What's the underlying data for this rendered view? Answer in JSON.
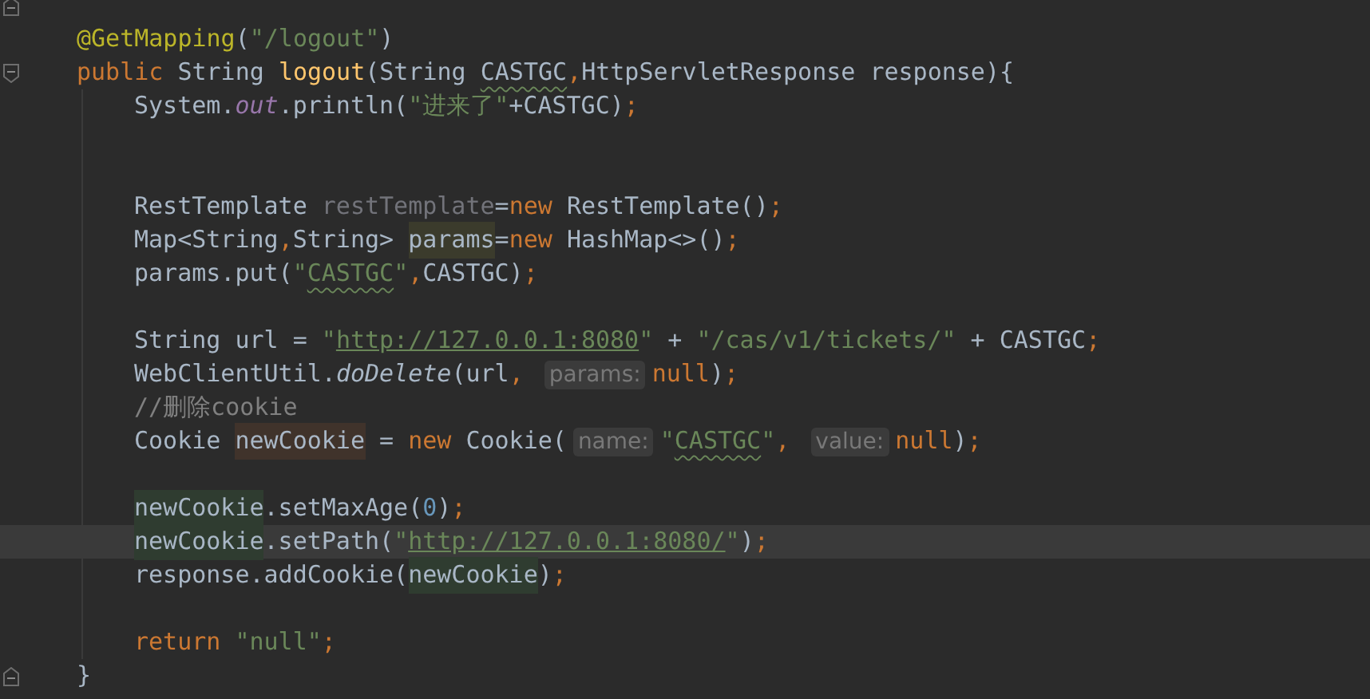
{
  "editor": {
    "lines": [
      {
        "kind": "blank",
        "gutter_marker": {
          "kind": "fold_end"
        }
      },
      {
        "kind": "code",
        "tokens": [
          {
            "kind": "annotation",
            "text": "@GetMapping"
          },
          {
            "kind": "plain",
            "text": "("
          },
          {
            "kind": "string",
            "text": "\"/logout\""
          },
          {
            "kind": "plain",
            "text": ")"
          }
        ]
      },
      {
        "kind": "code",
        "gutter_marker": {
          "kind": "fold_start"
        },
        "tokens": [
          {
            "kind": "keyword",
            "text": "public "
          },
          {
            "kind": "plain",
            "text": "String "
          },
          {
            "kind": "method",
            "text": "logout"
          },
          {
            "kind": "plain",
            "text": "(String "
          },
          {
            "kind": "plain",
            "text": "CASTGC",
            "squiggle": true
          },
          {
            "kind": "punct",
            "text": ","
          },
          {
            "kind": "plain",
            "text": "HttpServletResponse response){"
          }
        ],
        "children": [
          {
            "kind": "code",
            "tokens": [
              {
                "kind": "plain",
                "text": "System."
              },
              {
                "kind": "static",
                "text": "out"
              },
              {
                "kind": "plain",
                "text": ".println("
              },
              {
                "kind": "string",
                "text": "\"进来了\""
              },
              {
                "kind": "plain",
                "text": "+CASTGC)"
              },
              {
                "kind": "punct",
                "text": ";"
              }
            ]
          },
          {
            "kind": "blank"
          },
          {
            "kind": "blank"
          },
          {
            "kind": "code",
            "tokens": [
              {
                "kind": "plain",
                "text": "RestTemplate "
              },
              {
                "kind": "unused",
                "text": "restTemplate"
              },
              {
                "kind": "plain",
                "text": "="
              },
              {
                "kind": "keyword",
                "text": "new "
              },
              {
                "kind": "plain",
                "text": "RestTemplate()"
              },
              {
                "kind": "punct",
                "text": ";"
              }
            ]
          },
          {
            "kind": "code",
            "tokens": [
              {
                "kind": "plain",
                "text": "Map<String"
              },
              {
                "kind": "punct",
                "text": ","
              },
              {
                "kind": "plain",
                "text": "String> "
              },
              {
                "kind": "plain",
                "text": "params",
                "highlight": {
                  "kind": "identifier"
                }
              },
              {
                "kind": "plain",
                "text": "="
              },
              {
                "kind": "keyword",
                "text": "new "
              },
              {
                "kind": "plain",
                "text": "HashMap<>()"
              },
              {
                "kind": "punct",
                "text": ";"
              }
            ]
          },
          {
            "kind": "code",
            "tokens": [
              {
                "kind": "plain",
                "text": "params.put("
              },
              {
                "kind": "string",
                "text": "\""
              },
              {
                "kind": "string",
                "text": "CASTGC",
                "squiggle": true
              },
              {
                "kind": "string",
                "text": "\""
              },
              {
                "kind": "punct",
                "text": ","
              },
              {
                "kind": "plain",
                "text": "CASTGC)"
              },
              {
                "kind": "punct",
                "text": ";"
              }
            ]
          },
          {
            "kind": "blank"
          },
          {
            "kind": "code",
            "tokens": [
              {
                "kind": "plain",
                "text": "String url = "
              },
              {
                "kind": "string",
                "text": "\""
              },
              {
                "kind": "link",
                "text": "http://127.0.0.1:8080"
              },
              {
                "kind": "string",
                "text": "\""
              },
              {
                "kind": "plain",
                "text": " + "
              },
              {
                "kind": "string",
                "text": "\"/cas/v1/tickets/\""
              },
              {
                "kind": "plain",
                "text": " + CASTGC"
              },
              {
                "kind": "punct",
                "text": ";"
              }
            ]
          },
          {
            "kind": "code",
            "tokens": [
              {
                "kind": "plain",
                "text": "WebClientUtil."
              },
              {
                "kind": "static_method",
                "text": "doDelete"
              },
              {
                "kind": "plain",
                "text": "(url"
              },
              {
                "kind": "punct",
                "text": ", "
              },
              {
                "kind": "hint",
                "text": "params:"
              },
              {
                "kind": "keyword",
                "text": "null"
              },
              {
                "kind": "plain",
                "text": ")"
              },
              {
                "kind": "punct",
                "text": ";"
              }
            ]
          },
          {
            "kind": "code",
            "tokens": [
              {
                "kind": "comment",
                "text": "//删除cookie"
              }
            ]
          },
          {
            "kind": "code",
            "tokens": [
              {
                "kind": "plain",
                "text": "Cookie "
              },
              {
                "kind": "plain",
                "text": "newCookie",
                "highlight": {
                  "kind": "write"
                }
              },
              {
                "kind": "plain",
                "text": " = "
              },
              {
                "kind": "keyword",
                "text": "new "
              },
              {
                "kind": "plain",
                "text": "Cookie("
              },
              {
                "kind": "hint",
                "text": "name:"
              },
              {
                "kind": "string",
                "text": "\""
              },
              {
                "kind": "string",
                "text": "CASTGC",
                "squiggle": true
              },
              {
                "kind": "string",
                "text": "\""
              },
              {
                "kind": "punct",
                "text": ", "
              },
              {
                "kind": "hint",
                "text": "value:"
              },
              {
                "kind": "keyword",
                "text": "null"
              },
              {
                "kind": "plain",
                "text": ")"
              },
              {
                "kind": "punct",
                "text": ";"
              }
            ]
          },
          {
            "kind": "blank"
          },
          {
            "kind": "code",
            "tokens": [
              {
                "kind": "plain",
                "text": "newCookie",
                "highlight": {
                  "kind": "read"
                }
              },
              {
                "kind": "plain",
                "text": ".setMaxAge("
              },
              {
                "kind": "number",
                "text": "0"
              },
              {
                "kind": "plain",
                "text": ")"
              },
              {
                "kind": "punct",
                "text": ";"
              }
            ]
          },
          {
            "kind": "code",
            "current": true,
            "tokens": [
              {
                "kind": "plain",
                "text": "newCookie",
                "highlight": {
                  "kind": "read"
                }
              },
              {
                "kind": "plain",
                "text": ".setPath("
              },
              {
                "kind": "string",
                "text": "\""
              },
              {
                "kind": "link",
                "text": "http://127.0.0.1:8080/"
              },
              {
                "kind": "string",
                "text": "\""
              },
              {
                "kind": "plain",
                "text": ")"
              },
              {
                "kind": "punct",
                "text": ";"
              }
            ]
          },
          {
            "kind": "code",
            "tokens": [
              {
                "kind": "plain",
                "text": "response.addCookie("
              },
              {
                "kind": "plain",
                "text": "newCookie",
                "highlight": {
                  "kind": "read"
                }
              },
              {
                "kind": "plain",
                "text": ")"
              },
              {
                "kind": "punct",
                "text": ";"
              }
            ]
          },
          {
            "kind": "blank"
          },
          {
            "kind": "code",
            "tokens": [
              {
                "kind": "keyword",
                "text": "return "
              },
              {
                "kind": "string",
                "text": "\"null\""
              },
              {
                "kind": "punct",
                "text": ";"
              }
            ]
          }
        ]
      },
      {
        "kind": "code",
        "gutter_marker": {
          "kind": "fold_end"
        },
        "tokens": [
          {
            "kind": "plain",
            "text": "}"
          }
        ]
      }
    ]
  }
}
